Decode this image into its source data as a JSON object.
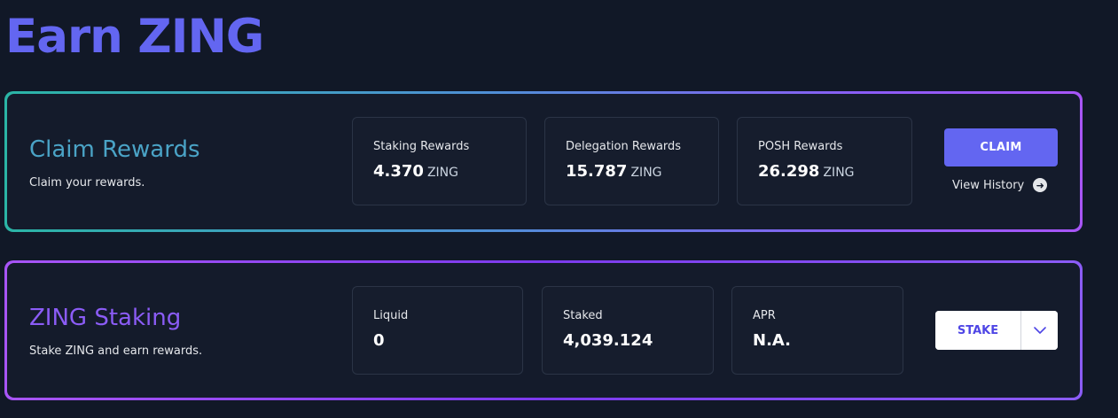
{
  "page": {
    "title": "Earn ZING"
  },
  "claim": {
    "title": "Claim Rewards",
    "subtitle": "Claim your rewards.",
    "stats": [
      {
        "label": "Staking Rewards",
        "value": "4.370",
        "unit": "ZING"
      },
      {
        "label": "Delegation Rewards",
        "value": "15.787",
        "unit": "ZING"
      },
      {
        "label": "POSH Rewards",
        "value": "26.298",
        "unit": "ZING"
      }
    ],
    "button_label": "CLAIM",
    "history_label": "View History"
  },
  "staking": {
    "title": "ZING Staking",
    "subtitle": "Stake ZING and earn rewards.",
    "stats": [
      {
        "label": "Liquid",
        "value": "0"
      },
      {
        "label": "Staked",
        "value": "4,039.124"
      },
      {
        "label": "APR",
        "value": "N.A."
      }
    ],
    "button_label": "STAKE"
  },
  "colors": {
    "accent": "#6366f1",
    "background": "#111827",
    "claim_title": "#4aa3c6",
    "staking_title": "#8b5cf6"
  },
  "icons": {
    "history": "arrow-right-circle-icon",
    "dropdown": "chevron-down-icon"
  }
}
